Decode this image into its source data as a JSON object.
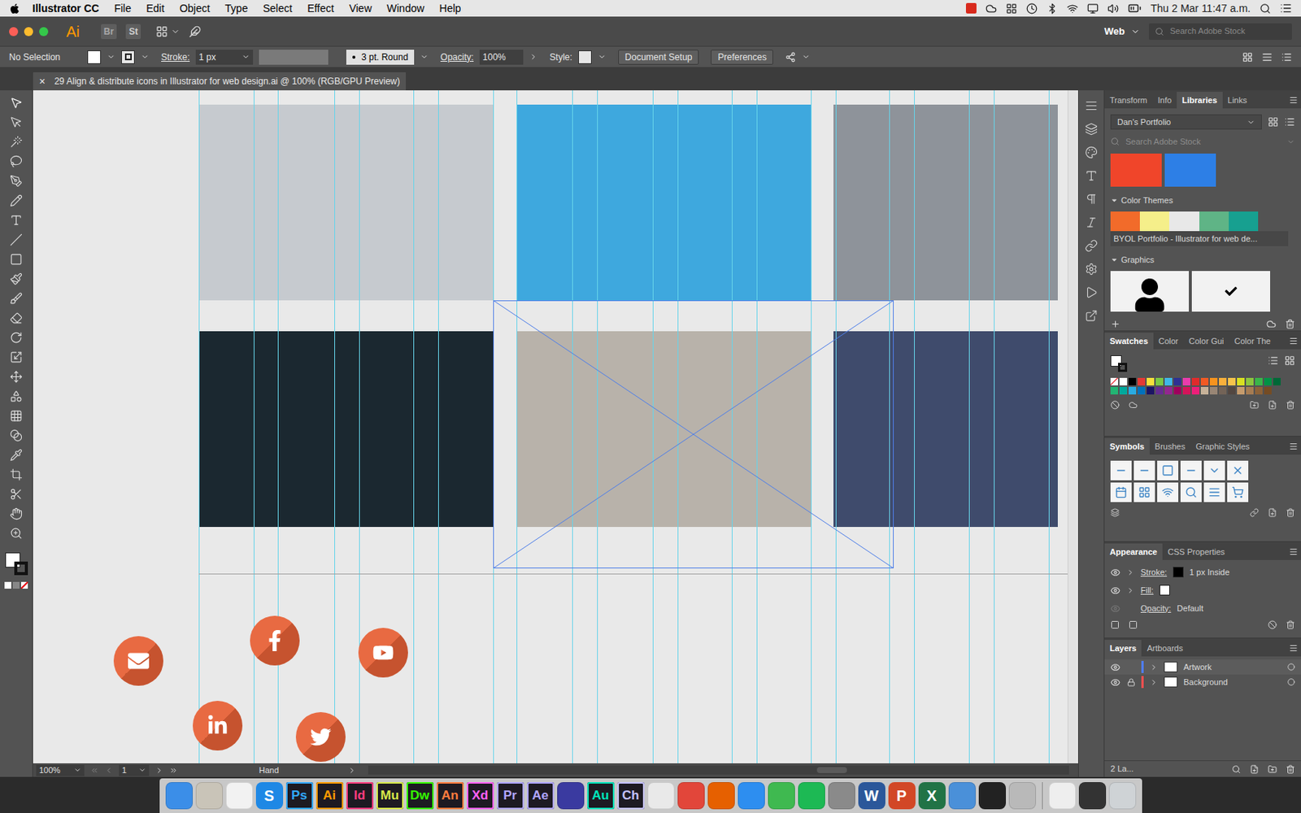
{
  "menuBar": {
    "items": [
      "Illustrator CC",
      "File",
      "Edit",
      "Object",
      "Type",
      "Select",
      "Effect",
      "View",
      "Window",
      "Help"
    ],
    "clock": "Thu 2 Mar 11:47 a.m."
  },
  "appBar": {
    "logo": "Ai",
    "bridge": "Br",
    "stock": "St",
    "workspace": "Web",
    "search": {
      "placeholder": "Search Adobe Stock"
    }
  },
  "controlBar": {
    "selection": "No Selection",
    "strokeLabel": "Stroke:",
    "strokeWeight": "1 px",
    "brush": "3 pt. Round",
    "opacityLabel": "Opacity:",
    "opacity": "100%",
    "styleLabel": "Style:",
    "buttons": [
      "Document Setup",
      "Preferences"
    ]
  },
  "document": {
    "close": "×",
    "title": "29 Align & distribute icons in Illustrator for web design.ai @ 100% (RGB/GPU Preview)"
  },
  "canvas": {
    "photos": [
      {
        "color": "#c6cacf",
        "selected": false
      },
      {
        "color": "#3ea8de",
        "selected": false
      },
      {
        "color": "#8e939a",
        "selected": false
      },
      {
        "color": "#1b2830",
        "selected": false
      },
      {
        "color": "#b8b2aa",
        "selected": true
      },
      {
        "color": "#3f4b6c",
        "selected": false
      }
    ]
  },
  "libraries": {
    "tabs": [
      {
        "label": "Transform",
        "selected": false
      },
      {
        "label": "Info",
        "selected": false
      },
      {
        "label": "Libraries",
        "selected": true
      },
      {
        "label": "Links",
        "selected": false
      }
    ],
    "library": "Dan's Portfolio",
    "search": {
      "placeholder": "Search Adobe Stock"
    },
    "colors": [
      {
        "color": "#f0452a"
      },
      {
        "color": "#2d7fe6"
      }
    ],
    "sections": [
      {
        "label": "Color Themes",
        "expanded": true
      },
      {
        "label": "Graphics",
        "expanded": true
      }
    ],
    "theme": {
      "name": "BYOL Portfolio - Illustrator for web de...",
      "colors": [
        {
          "color": "#f26b2a"
        },
        {
          "color": "#f5ef8a"
        },
        {
          "color": "#e8e8e8"
        },
        {
          "color": "#5fb486"
        },
        {
          "color": "#17a090"
        }
      ]
    }
  },
  "swatchesPanel": {
    "tabs": [
      {
        "label": "Swatches",
        "selected": true
      },
      {
        "label": "Color",
        "selected": false
      },
      {
        "label": "Color Gui",
        "selected": false
      },
      {
        "label": "Color The",
        "selected": false
      }
    ],
    "swatches": [
      "#ffffff",
      "#000000",
      "#e53935",
      "#f7e13b",
      "#7ac943",
      "#3fb8e8",
      "#2e3192",
      "#e93cac",
      "#e02b2b",
      "#f15a24",
      "#f7931e",
      "#fbb03b",
      "#f8c44b",
      "#d9e021",
      "#8cc63f",
      "#39b54a",
      "#009245",
      "#006837",
      "#22b573",
      "#00a99d",
      "#29abe2",
      "#0071bc",
      "#1b1464",
      "#662d91",
      "#93278f",
      "#9e005d",
      "#d4145a",
      "#ed1e79",
      "#c7b299",
      "#998675",
      "#736357",
      "#534741",
      "#c69c6d",
      "#a67c52",
      "#8c6239",
      "#754c24"
    ]
  },
  "symbolsPanel": {
    "tabs": [
      {
        "label": "Symbols",
        "selected": true
      },
      {
        "label": "Brushes",
        "selected": false
      },
      {
        "label": "Graphic Styles",
        "selected": false
      }
    ]
  },
  "appearance": {
    "tabs": [
      {
        "label": "Appearance",
        "selected": true
      },
      {
        "label": "CSS Properties",
        "selected": false
      }
    ],
    "rows": [
      {
        "kind": "stroke",
        "label": "Stroke:",
        "color": "#000000",
        "value": "1 px Inside",
        "visible": true
      },
      {
        "kind": "fill",
        "label": "Fill:",
        "color": "#ffffff",
        "visible": true
      },
      {
        "kind": "opacity",
        "label": "Opacity:",
        "value": "Default",
        "visible": false
      }
    ]
  },
  "layers": {
    "tabs": [
      {
        "label": "Layers",
        "selected": true
      },
      {
        "label": "Artboards",
        "selected": false
      }
    ],
    "items": [
      {
        "name": "Artwork",
        "selected": true,
        "locked": false,
        "visible": true,
        "color": "#4f7dff"
      },
      {
        "name": "Background",
        "selected": false,
        "locked": true,
        "visible": true,
        "color": "#ff4f4f"
      }
    ],
    "count": "2 La..."
  },
  "statusBar": {
    "zoom": "100%",
    "artboard": "1",
    "tool": "Hand"
  },
  "dock": [
    {
      "kind": "plain",
      "color": "#3b8ee8"
    },
    {
      "kind": "plain",
      "color": "#c9c4b8"
    },
    {
      "kind": "plain",
      "color": "#f2f2f2"
    },
    {
      "kind": "letter",
      "label": "S",
      "color": "#1e88e5"
    },
    {
      "kind": "adobe",
      "label": "Ps",
      "color": "#31a8ff"
    },
    {
      "kind": "adobe",
      "label": "Ai",
      "color": "#ff9a00"
    },
    {
      "kind": "adobe",
      "label": "Id",
      "color": "#ff3d7f"
    },
    {
      "kind": "adobe",
      "label": "Mu",
      "color": "#d7e84a"
    },
    {
      "kind": "adobe",
      "label": "Dw",
      "color": "#35fa00"
    },
    {
      "kind": "adobe",
      "label": "An",
      "color": "#ff7c3e"
    },
    {
      "kind": "adobe",
      "label": "Xd",
      "color": "#ff61f6"
    },
    {
      "kind": "adobe",
      "label": "Pr",
      "color": "#b0a6ff"
    },
    {
      "kind": "adobe",
      "label": "Ae",
      "color": "#b0a6ff"
    },
    {
      "kind": "plain",
      "color": "#3a3aa0"
    },
    {
      "kind": "adobe",
      "label": "Au",
      "color": "#00e4bb"
    },
    {
      "kind": "adobe",
      "label": "Ch",
      "color": "#c5c2ff"
    },
    {
      "kind": "plain",
      "color": "#e9e9e9"
    },
    {
      "kind": "plain",
      "color": "#e2463a"
    },
    {
      "kind": "plain",
      "color": "#e66000"
    },
    {
      "kind": "plain",
      "color": "#2d8ef0"
    },
    {
      "kind": "plain",
      "color": "#3fb950"
    },
    {
      "kind": "plain",
      "color": "#1db954"
    },
    {
      "kind": "plain",
      "color": "#8a8a8a"
    },
    {
      "kind": "letter",
      "label": "W",
      "color": "#2b579a"
    },
    {
      "kind": "letter",
      "label": "P",
      "color": "#d24726"
    },
    {
      "kind": "letter",
      "label": "X",
      "color": "#217346"
    },
    {
      "kind": "plain",
      "color": "#4a90d9"
    },
    {
      "kind": "plain",
      "color": "#222222"
    },
    {
      "kind": "plain",
      "color": "#b9b9b9"
    },
    {
      "kind": "plain",
      "color": "#eeeeee"
    },
    {
      "kind": "plain",
      "color": "#333333"
    },
    {
      "kind": "plain",
      "color": "#cfd3d6"
    }
  ]
}
